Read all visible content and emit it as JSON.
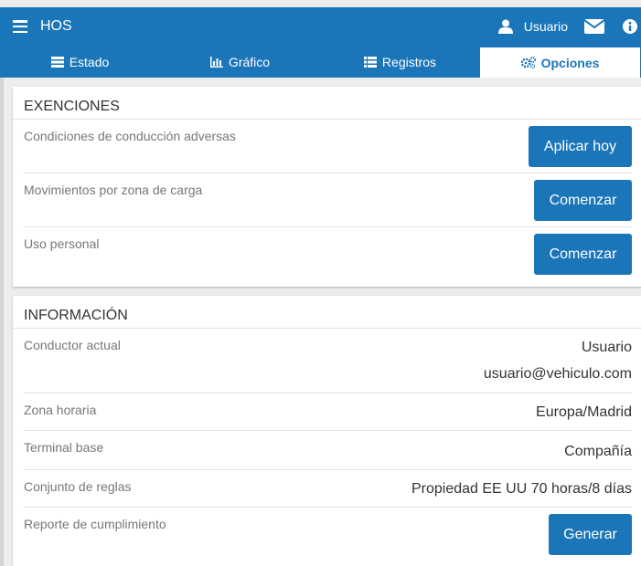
{
  "header": {
    "title": "HOS",
    "user_label": "Usuario",
    "icons": [
      "menu-icon",
      "user-icon",
      "mail-icon",
      "info-icon"
    ]
  },
  "tabs": [
    {
      "label": "Estado",
      "icon": "list-icon",
      "active": false
    },
    {
      "label": "Gráfico",
      "icon": "bar-chart-icon",
      "active": false
    },
    {
      "label": "Registros",
      "icon": "rows-icon",
      "active": false
    },
    {
      "label": "Opciones",
      "icon": "gears-icon",
      "active": true
    }
  ],
  "exemptions": {
    "title": "EXENCIONES",
    "rows": [
      {
        "label": "Condiciones de conducción adversas",
        "button": "Aplicar hoy"
      },
      {
        "label": "Movimientos por zona de carga",
        "button": "Comenzar"
      },
      {
        "label": "Uso personal",
        "button": "Comenzar"
      }
    ]
  },
  "information": {
    "title": "INFORMACIÓN",
    "current_driver": {
      "label": "Conductor actual",
      "name": "Usuario",
      "email": "usuario@vehiculo.com"
    },
    "timezone": {
      "label": "Zona horaria",
      "value": "Europa/Madrid"
    },
    "home_terminal": {
      "label": "Terminal base",
      "value": "Compañía"
    },
    "ruleset": {
      "label": "Conjunto de reglas",
      "value": "Propiedad EE UU 70 horas/8 días"
    },
    "compliance": {
      "label": "Reporte de cumplimiento",
      "button": "Generar"
    }
  },
  "colors": {
    "primary": "#1b75b9",
    "background": "#ededed",
    "card": "#ffffff"
  }
}
